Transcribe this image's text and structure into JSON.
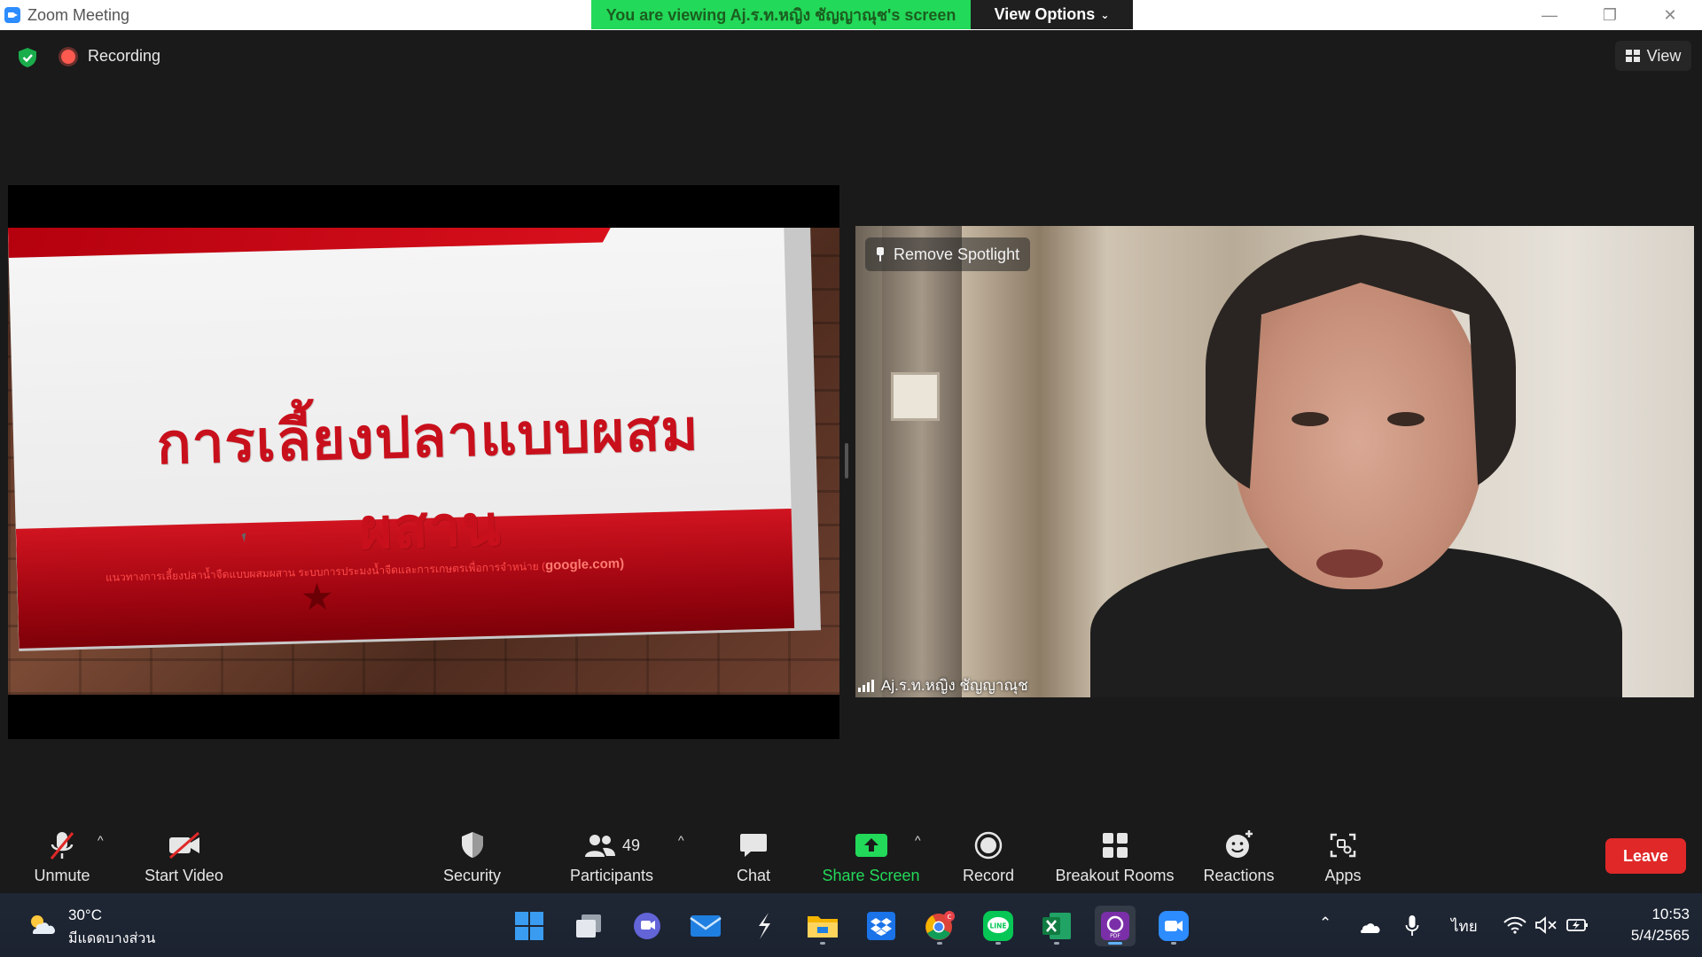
{
  "window": {
    "title": "Zoom Meeting",
    "viewing_banner": "You are viewing Aj.ร.ท.หญิง ชัญญาณุช's screen",
    "view_options_label": "View Options",
    "minimize": "—",
    "restore": "❐",
    "close": "✕"
  },
  "meeting": {
    "recording_label": "Recording",
    "view_label": "View"
  },
  "shared_slide": {
    "title": "การเลี้ยงปลาแบบผสมผสาน",
    "subtitle_text": "แนวทางการเลี้ยงปลาน้ำจืดแบบผสมผสาน ระบบการประมงน้ำจืดและการเกษตรเพื่อการจำหน่าย (",
    "subtitle_link": "google.com)"
  },
  "video": {
    "spotlight_label": "Remove Spotlight",
    "participant_name": "Aj.ร.ท.หญิง ชัญญาณุช"
  },
  "toolbar": {
    "unmute": "Unmute",
    "start_video": "Start Video",
    "security": "Security",
    "participants": "Participants",
    "participants_count": "49",
    "chat": "Chat",
    "share_screen": "Share Screen",
    "record": "Record",
    "breakout_rooms": "Breakout Rooms",
    "reactions": "Reactions",
    "apps": "Apps",
    "leave": "Leave"
  },
  "colors": {
    "share_green": "#23d959",
    "leave_red": "#e02828",
    "slide_red": "#c8101c",
    "recording_red": "#ff5a50"
  },
  "taskbar": {
    "weather_temp": "30°C",
    "weather_desc": "มีแดดบางส่วน",
    "language": "ไทย",
    "time": "10:53",
    "date": "5/4/2565",
    "chrome_badge": "c",
    "apps": [
      "windows-start-icon",
      "task-view-icon",
      "teams-chat-icon",
      "mail-icon",
      "app-s-icon",
      "file-explorer-icon",
      "dropbox-icon",
      "chrome-icon",
      "line-icon",
      "excel-icon",
      "pdf-app-icon",
      "zoom-icon"
    ]
  }
}
